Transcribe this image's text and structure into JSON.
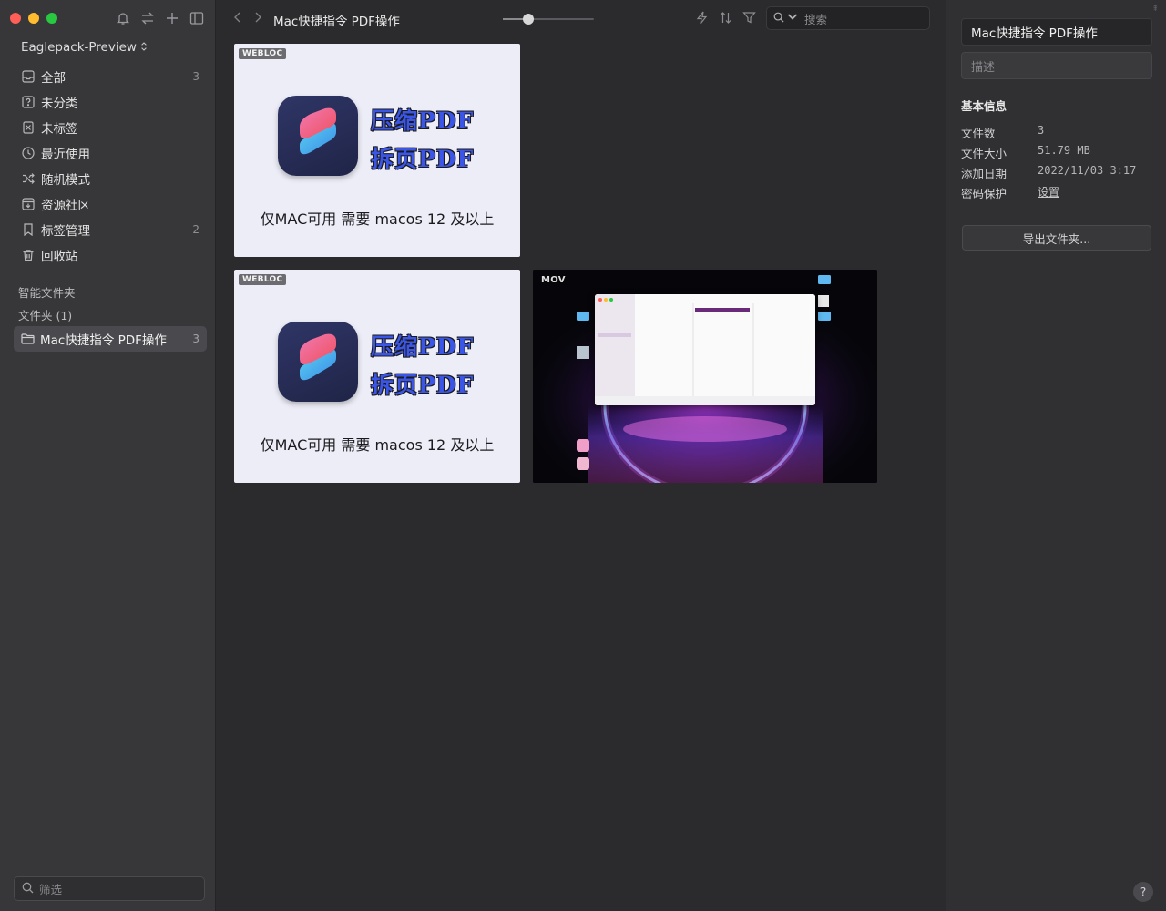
{
  "window": {
    "controls": {
      "close_color": "#ff5f57",
      "minimize_color": "#febc2e",
      "zoom_color": "#28c840"
    }
  },
  "sidebar": {
    "toolbar_icons": [
      "bell-icon",
      "swap-icon",
      "plus-icon",
      "sidebar-toggle-icon"
    ],
    "library_name": "Eaglepack-Preview",
    "library_chevron": "⌃⌄",
    "items": [
      {
        "label": "全部",
        "count": "3",
        "icon": "inbox-icon"
      },
      {
        "label": "未分类",
        "count": "",
        "icon": "question-box-icon"
      },
      {
        "label": "未标签",
        "count": "",
        "icon": "tag-off-icon"
      },
      {
        "label": "最近使用",
        "count": "",
        "icon": "clock-icon"
      },
      {
        "label": "随机模式",
        "count": "",
        "icon": "shuffle-icon"
      },
      {
        "label": "资源社区",
        "count": "",
        "icon": "community-icon"
      },
      {
        "label": "标签管理",
        "count": "2",
        "icon": "bookmark-icon"
      },
      {
        "label": "回收站",
        "count": "",
        "icon": "trash-icon"
      }
    ],
    "smart_folders_title": "智能文件夹",
    "folders_title": "文件夹 (1)",
    "folder": {
      "label": "Mac快捷指令 PDF操作",
      "count": "3"
    },
    "filter_placeholder": "筛选"
  },
  "main": {
    "breadcrumb": "Mac快捷指令 PDF操作",
    "zoom_level": 0.25,
    "search_placeholder": "搜索",
    "toolbar_icons": [
      "lightning-icon",
      "sort-icon",
      "filter-icon"
    ],
    "items": [
      {
        "type_badge": "WEBLOC",
        "line1": "压缩PDF",
        "line2": "拆页PDF",
        "caption": "仅MAC可用 需要 macos 12 及以上"
      },
      {
        "type_badge": "WEBLOC",
        "line1": "压缩PDF",
        "line2": "拆页PDF",
        "caption": "仅MAC可用 需要 macos 12 及以上"
      },
      {
        "type_badge": "MOV"
      }
    ]
  },
  "inspector": {
    "title_value": "Mac快捷指令 PDF操作",
    "description_placeholder": "描述",
    "info_title": "基本信息",
    "rows": [
      {
        "key": "文件数",
        "value": "3"
      },
      {
        "key": "文件大小",
        "value": "51.79 MB"
      },
      {
        "key": "添加日期",
        "value": "2022/11/03 3:17"
      },
      {
        "key": "密码保护",
        "value": "设置"
      }
    ],
    "export_label": "导出文件夹...",
    "help_label": "?"
  }
}
